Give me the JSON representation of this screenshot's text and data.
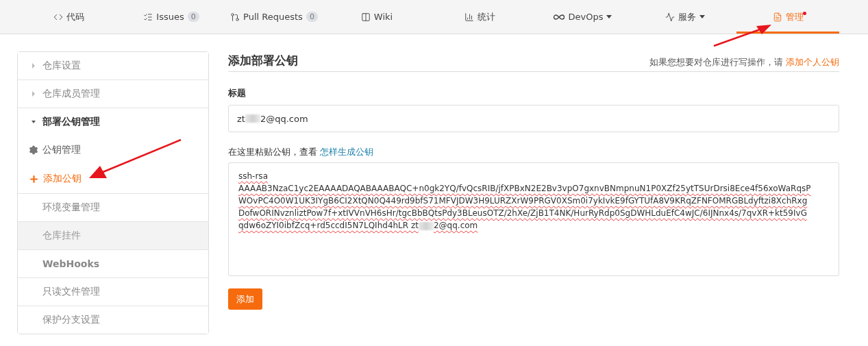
{
  "nav": {
    "tabs": [
      {
        "kind": "code",
        "label": "代码",
        "selected": false
      },
      {
        "kind": "issues",
        "label": "Issues",
        "count": "0",
        "selected": false
      },
      {
        "kind": "pulls",
        "label": "Pull Requests",
        "count": "0",
        "selected": false
      },
      {
        "kind": "wiki",
        "label": "Wiki",
        "selected": false
      },
      {
        "kind": "stats",
        "label": "统计",
        "selected": false
      },
      {
        "kind": "devops",
        "label": "DevOps",
        "dropdown": true,
        "selected": false
      },
      {
        "kind": "service",
        "label": "服务",
        "dropdown": true,
        "selected": false
      },
      {
        "kind": "manage",
        "label": "管理",
        "notification": true,
        "selected": true
      }
    ]
  },
  "sidebar": {
    "items": [
      {
        "kind": "group",
        "label": "仓库设置",
        "expanded": false
      },
      {
        "kind": "group",
        "label": "仓库成员管理",
        "expanded": false
      },
      {
        "kind": "group",
        "label": "部署公钥管理",
        "expanded": true,
        "children": [
          {
            "kind": "settings",
            "label": "公钥管理",
            "selected": false
          },
          {
            "kind": "add",
            "label": "添加公钥",
            "selected": true
          }
        ]
      },
      {
        "kind": "item",
        "label": "环境变量管理",
        "disabled": false
      },
      {
        "kind": "item",
        "label": "仓库挂件",
        "disabled": true
      },
      {
        "kind": "item",
        "label": "WebHooks",
        "disabled": false,
        "bold": true
      },
      {
        "kind": "item",
        "label": "只读文件管理",
        "disabled": false
      },
      {
        "kind": "item",
        "label": "保护分支设置",
        "disabled": false
      }
    ]
  },
  "main": {
    "title": "添加部署公钥",
    "hint": "如果您想要对仓库进行写操作，请",
    "hint_link": "添加个人公钥",
    "title_field": {
      "label": "标题",
      "value_start": "zt",
      "value_end": "2@qq.com",
      "masked": true
    },
    "key_field": {
      "label": "在这里粘贴公钥，查看",
      "label_link": "怎样生成公钥",
      "lines": [
        "ssh-rsa",
        "AAAAB3NzaC1yc2EAAAADAQABAAABAQC+n0gk2YQ/fvQcsRIB/jfXPBxN2E2Bv3vpO7gxnvBNmpnuN1P0XZf25ytTSUrDrsi8Ece4f56xoWaRqsP",
        "WOvPC4O0W1UK3IYgB6CI2XtQN0Q449rd9bfS71MFVJDW3H9LURZXrW9PRGV0XSm0i7ykIvkE9fGYTUfA8V9KRqZFNFOMRGBLdyftzi8XchRxg",
        "DofwORINvznliztPow7f+xtIVVnVH6sHr/tgcBbBQtsPdy3BLeusOTZ/2hXe/ZjB1T4NK/HurRyRdp0SgDWHLduEfC4wJC/6IJNnx4s/7qvXR+kt59IvG"
      ],
      "last_line_start": "qdw6oZYI0ibfZcq+rd5ccdI5N7LQIhd4hLR zt",
      "last_line_end": "2@qq.com",
      "masked": true
    },
    "submit": "添加"
  }
}
